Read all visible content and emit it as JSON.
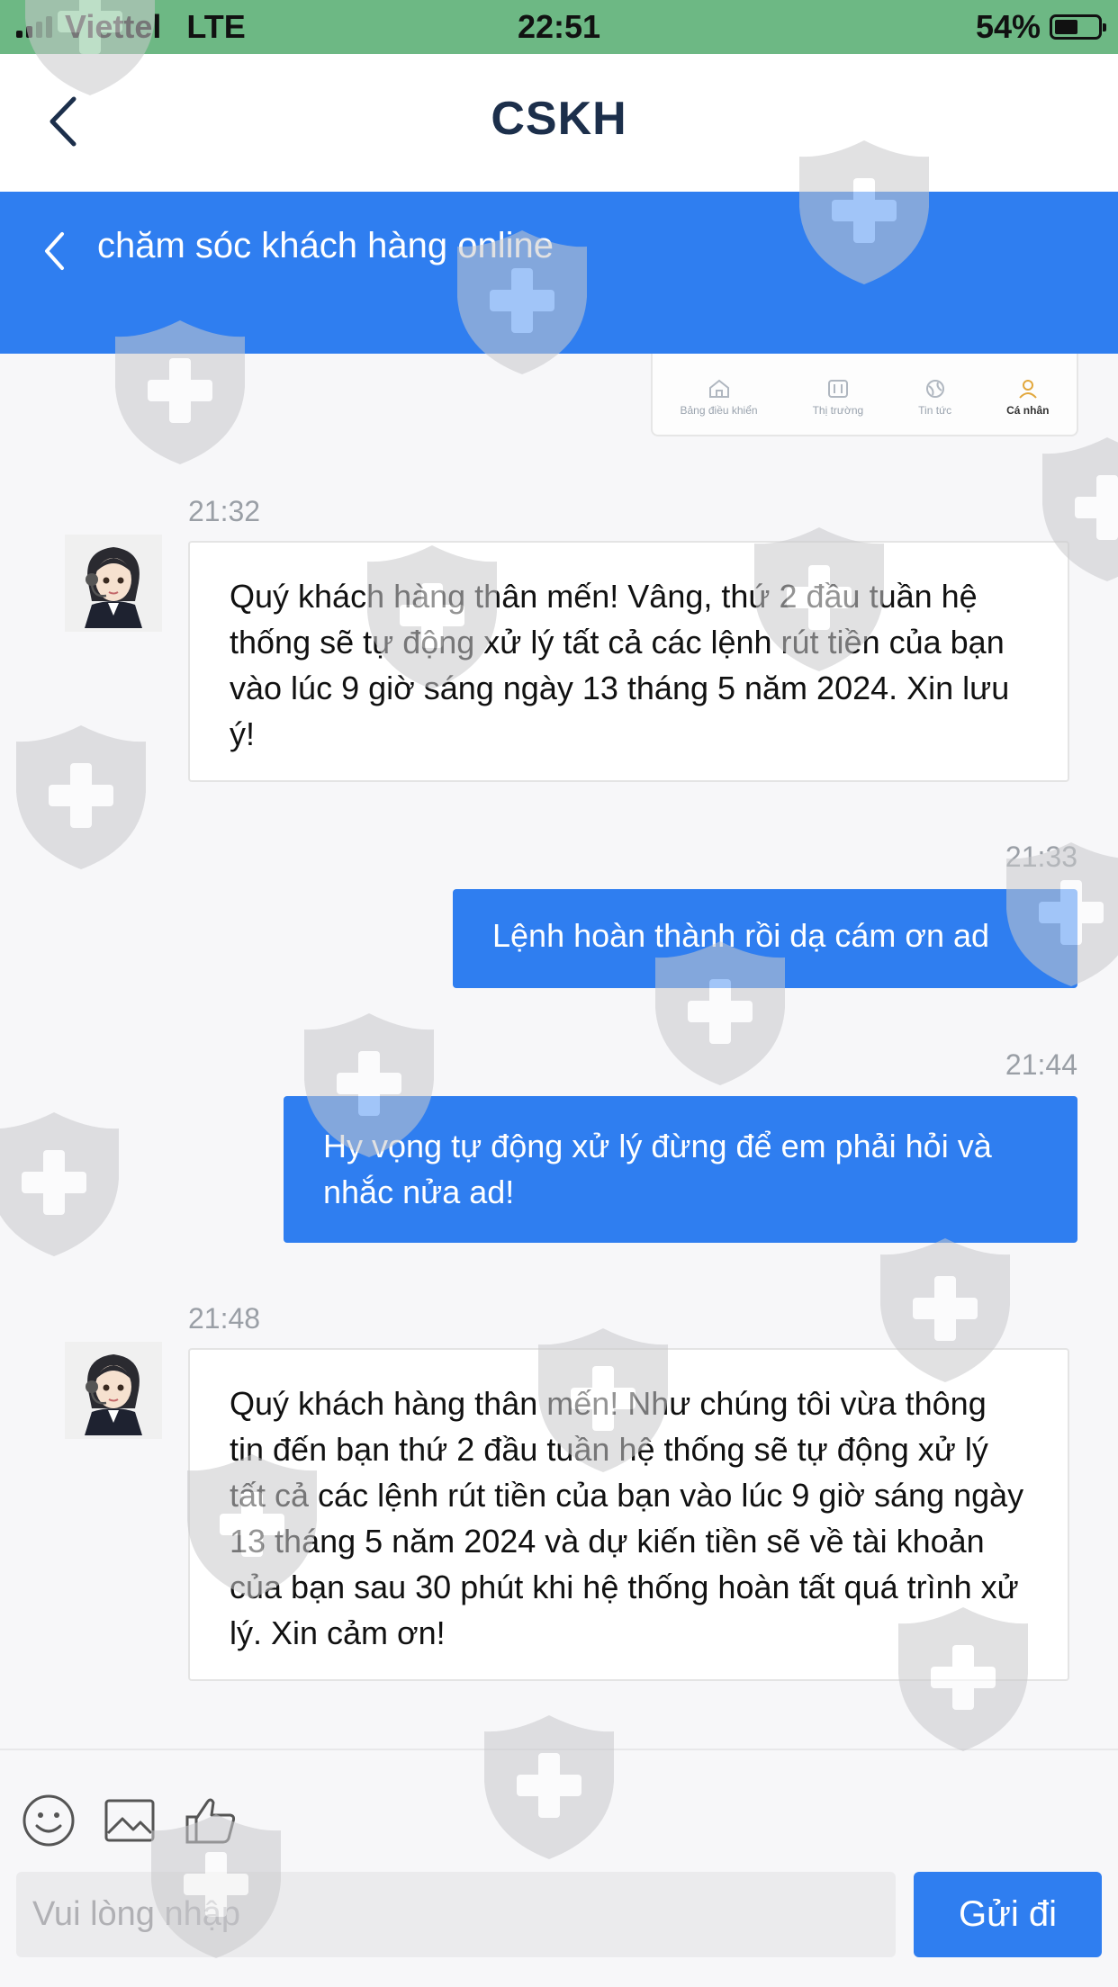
{
  "status_bar": {
    "carrier": "Viettel",
    "network": "LTE",
    "time": "22:51",
    "battery": "54%",
    "battery_level": 0.54
  },
  "nav": {
    "title": "CSKH",
    "back_icon": "chevron-left-icon"
  },
  "sub_header": {
    "title": "chăm sóc khách hàng online",
    "back_icon": "chevron-left-icon"
  },
  "snippet_tabs": [
    {
      "label": "Bảng điều khiển",
      "icon": "home-icon"
    },
    {
      "label": "Thị trường",
      "icon": "sliders-icon"
    },
    {
      "label": "Tin tức",
      "icon": "globe-icon"
    },
    {
      "label": "Cá nhân",
      "icon": "user-icon"
    }
  ],
  "messages": [
    {
      "direction": "in",
      "time": "21:32",
      "text": "Quý khách hàng thân mến! Vâng, thứ 2 đầu tuần hệ thống sẽ tự động xử lý tất cả các lệnh rút tiền của bạn vào lúc 9 giờ sáng ngày 13 tháng 5 năm 2024. Xin lưu ý!"
    },
    {
      "direction": "out",
      "time": "21:33",
      "text": "Lệnh hoàn thành rồi dạ cám ơn ad"
    },
    {
      "direction": "out",
      "time": "21:44",
      "text": "Hy vọng tự động xử lý đừng để em phải hỏi và nhắc nửa ad!"
    },
    {
      "direction": "in",
      "time": "21:48",
      "text": "Quý khách hàng thân mến! Như chúng tôi vừa thông tin đến bạn thứ 2 đầu tuần hệ thống sẽ tự động xử lý tất cả các lệnh rút tiền của bạn vào lúc 9 giờ sáng ngày 13 tháng 5 năm 2024 và dự kiến tiền sẽ về tài khoản của bạn sau 30 phút khi hệ thống hoàn tất quá trình xử lý. Xin cảm ơn!"
    }
  ],
  "composer": {
    "placeholder": "Vui lòng nhập",
    "value": "",
    "send_label": "Gửi đi",
    "tools": [
      "emoji-icon",
      "image-icon",
      "thumbs-up-icon"
    ]
  },
  "colors": {
    "status_bar": "#6db884",
    "accent": "#2f7ef0",
    "title": "#1c2f4b"
  }
}
